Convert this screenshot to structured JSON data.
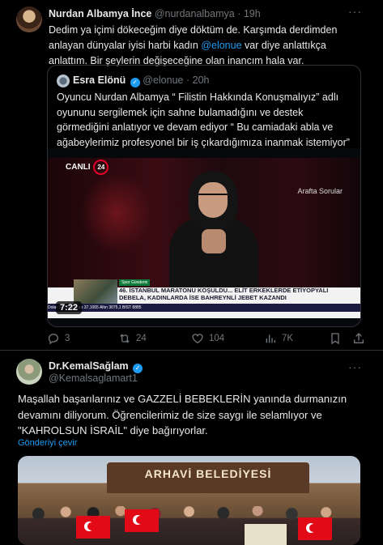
{
  "post1": {
    "author_name": "Nurdan Albamya İnce",
    "handle": "@nurdanalbamya",
    "separator": "·",
    "time": "19h",
    "text_before": "Dedim ya içimi dökeceğim diye döktüm de. Karşımda derdimden anlayan dünyalar iyisi harbi kadın ",
    "mention": "@elonue",
    "text_after": " var diye anlattıkça anlattım. Bir şeylerin değişeceğine olan inancım hala var.",
    "more_label": "···",
    "quote": {
      "author_name": "Esra Elönü",
      "handle": "@elonue",
      "separator": "·",
      "time": "20h",
      "text": "Oyuncu Nurdan Albamya “ Filistin Hakkında Konuşmalıyız” adlı oyununu sergilemek için sahne bulamadığını ve destek görmediğini anlatıyor ve devam ediyor “ Bu camiadaki abla ve ağabeylerimiz profesyonel bir iş çıkardığımıza inanmak istemiyor” Üzücü ..",
      "video": {
        "live_label": "CANLI",
        "channel_number": "24",
        "program": "Arafta Sorular",
        "ticker_tag": "Spor Gündemi",
        "ticker_line1": "46. İSTANBUL MARATONU KOŞULDU... ELİT ERKEKLERDE ETİYOPYALI",
        "ticker_line2": "DEBELA, KADINLARDA İSE BAHREYNLİ JEBET KAZANDI",
        "ticker_bottom": "Dolar 34,3403   Euro 37,1065   Altın 3075,1   BIST 8885",
        "duration": "7:22"
      }
    },
    "actions": {
      "replies": "3",
      "reposts": "24",
      "likes": "104",
      "views": "7K"
    }
  },
  "post2": {
    "author_name": "Dr.KemalSağlam",
    "handle": "@Kemalsaglamart1",
    "more_label": "···",
    "text": "Maşallah başarılarınız ve GAZZELİ BEBEKLERİN yanında durmanızın devamını diliyorum. Öğrencilerimiz de size saygı ile selamlıyor ve \"KAHROLSUN İSRAİL\" diye bağırıyorlar.",
    "translate_label": "Gönderiyi çevir",
    "photo_sign": "ARHAVİ BELEDİYESİ"
  },
  "colors": {
    "background": "#000000",
    "text": "#e7e9ea",
    "muted": "#71767b",
    "accent": "#1d9bf0",
    "border": "#2f3336"
  },
  "icons": [
    "more-icon",
    "verified-icon",
    "reply-icon",
    "retweet-icon",
    "like-icon",
    "views-icon",
    "bookmark-icon",
    "share-icon"
  ]
}
